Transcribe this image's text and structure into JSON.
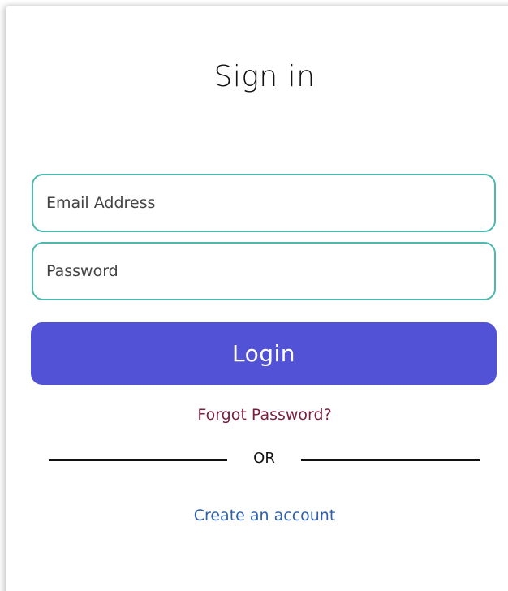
{
  "header": {
    "title": "Sign in"
  },
  "form": {
    "email_placeholder": "Email Address",
    "password_placeholder": "Password",
    "login_label": "Login",
    "forgot_label": "Forgot Password?",
    "divider_label": "OR",
    "create_account_label": "Create an account"
  },
  "colors": {
    "input_border": "#4db8ad",
    "login_button": "#5252d6",
    "forgot_link": "#7a1f3f",
    "create_link": "#2f5fa8"
  }
}
